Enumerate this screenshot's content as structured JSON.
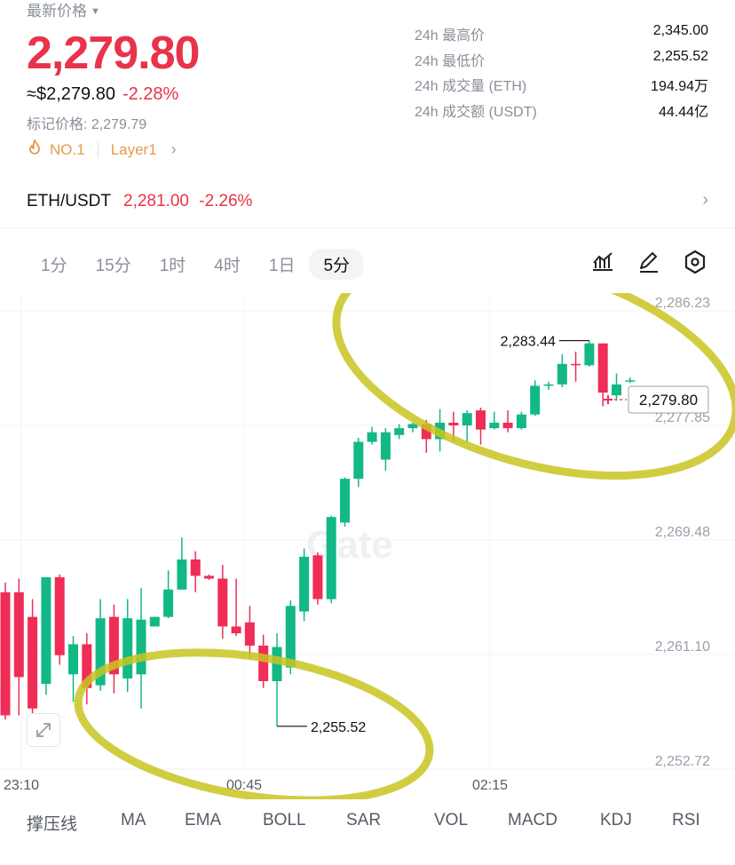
{
  "header": {
    "latest_price_label": "最新价格",
    "last_price": "2,279.80",
    "usd_price": "≈$2,279.80",
    "change_pct": "-2.28%",
    "mark_price": "标记价格: 2,279.79",
    "tag_rank": "NO.1",
    "tag_category": "Layer1"
  },
  "stats": [
    {
      "label": "24h 最高价",
      "value": "2,345.00"
    },
    {
      "label": "24h 最低价",
      "value": "2,255.52"
    },
    {
      "label": "24h 成交量 (ETH)",
      "value": "194.94万"
    },
    {
      "label": "24h 成交额 (USDT)",
      "value": "44.44亿"
    }
  ],
  "pair": {
    "symbol": "ETH/USDT",
    "price": "2,281.00",
    "change": "-2.26%"
  },
  "timeframes": [
    "1分",
    "15分",
    "1时",
    "4时",
    "1日",
    "5分"
  ],
  "active_timeframe": "5分",
  "indicators": [
    "撑压线",
    "MA",
    "EMA",
    "BOLL",
    "SAR",
    "VOL",
    "MACD",
    "KDJ",
    "RSI"
  ],
  "colors": {
    "up": "#12b886",
    "down": "#ef2d56",
    "accent_red": "#e8334a",
    "tag_orange": "#e89a4a",
    "highlight": "#c9c420"
  },
  "chart_data": {
    "type": "candlestick",
    "y_ticks": [
      "2,286.23",
      "2,277.85",
      "2,269.48",
      "2,261.10",
      "2,252.72"
    ],
    "y_tick_values": [
      2286.23,
      2277.85,
      2269.48,
      2261.1,
      2252.72
    ],
    "x_ticks": [
      "23:10",
      "00:45",
      "02:15"
    ],
    "ylim": [
      2250.5,
      2290.0
    ],
    "high_marker": "2,283.44",
    "low_marker": "2,255.52",
    "last_price_tag": "2,279.80",
    "watermark": "Gate",
    "candles": [
      [
        2265.0,
        2256.0,
        2265.7,
        2255.7
      ],
      [
        2265.0,
        2258.8,
        2266.0,
        2256.0
      ],
      [
        2263.2,
        2256.5,
        2264.5,
        2256.0
      ],
      [
        2258.3,
        2266.1,
        2266.1,
        2257.5
      ],
      [
        2266.1,
        2260.4,
        2266.3,
        2259.7
      ],
      [
        2259.0,
        2261.2,
        2261.8,
        2257.0
      ],
      [
        2261.2,
        2258.0,
        2262.0,
        2256.8
      ],
      [
        2258.2,
        2263.1,
        2264.5,
        2257.8
      ],
      [
        2263.2,
        2259.0,
        2264.1,
        2257.6
      ],
      [
        2258.7,
        2263.1,
        2264.5,
        2257.7
      ],
      [
        2259.0,
        2263.0,
        2265.3,
        2256.5
      ],
      [
        2262.5,
        2263.2,
        2263.2,
        2262.5
      ],
      [
        2263.2,
        2265.2,
        2266.6,
        2263.1
      ],
      [
        2265.2,
        2267.4,
        2269.0,
        2265.2
      ],
      [
        2267.4,
        2266.2,
        2268.0,
        2265.0
      ],
      [
        2266.2,
        2266.0,
        2266.3,
        2265.9
      ],
      [
        2266.0,
        2262.5,
        2267.0,
        2261.6
      ],
      [
        2262.5,
        2262.0,
        2266.0,
        2261.8
      ],
      [
        2262.8,
        2261.1,
        2264.0,
        2260.1
      ],
      [
        2261.1,
        2258.5,
        2261.9,
        2258.0
      ],
      [
        2258.5,
        2261.0,
        2262.0,
        2255.2
      ],
      [
        2259.5,
        2264.0,
        2264.4,
        2259.0
      ],
      [
        2263.6,
        2267.6,
        2268.2,
        2262.9
      ],
      [
        2267.7,
        2264.5,
        2267.9,
        2264.1
      ],
      [
        2264.5,
        2270.5,
        2270.6,
        2264.2
      ],
      [
        2270.1,
        2273.3,
        2273.4,
        2269.8
      ],
      [
        2273.3,
        2276.0,
        2276.3,
        2272.7
      ],
      [
        2276.0,
        2276.7,
        2277.1,
        2275.8
      ],
      [
        2274.7,
        2276.7,
        2277.0,
        2273.9
      ],
      [
        2276.5,
        2277.0,
        2277.3,
        2276.2
      ],
      [
        2277.0,
        2277.3,
        2277.4,
        2276.7
      ],
      [
        2277.3,
        2276.2,
        2277.6,
        2275.2
      ],
      [
        2276.2,
        2277.4,
        2278.4,
        2275.3
      ],
      [
        2277.4,
        2277.2,
        2278.2,
        2276.0
      ],
      [
        2277.2,
        2278.1,
        2278.3,
        2275.9
      ],
      [
        2278.3,
        2276.9,
        2278.5,
        2275.8
      ],
      [
        2277.0,
        2277.4,
        2278.2,
        2276.9
      ],
      [
        2277.4,
        2277.0,
        2278.3,
        2276.7
      ],
      [
        2277.0,
        2278.0,
        2278.2,
        2276.9
      ],
      [
        2278.0,
        2280.1,
        2280.5,
        2277.9
      ],
      [
        2280.1,
        2280.2,
        2280.4,
        2279.8
      ],
      [
        2280.2,
        2281.7,
        2282.4,
        2280.0
      ],
      [
        2281.7,
        2281.6,
        2282.6,
        2280.4
      ],
      [
        2281.6,
        2283.2,
        2283.4,
        2281.5
      ],
      [
        2283.2,
        2279.6,
        2283.2,
        2278.6
      ],
      [
        2279.4,
        2280.2,
        2281.0,
        2279.0
      ],
      [
        2280.5,
        2280.5,
        2280.7,
        2280.3
      ]
    ]
  }
}
